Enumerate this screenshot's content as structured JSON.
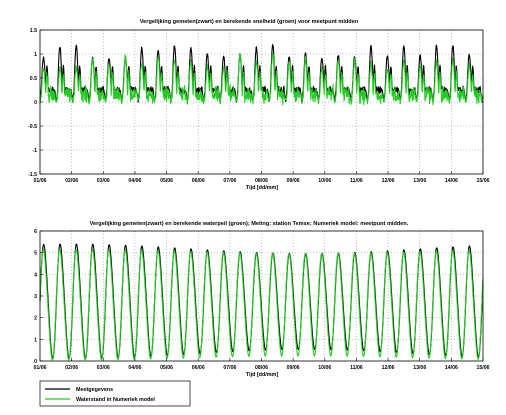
{
  "chart_data": [
    {
      "type": "line",
      "title": "Vergelijking gemeten(zwart) en berekende snelheid (groen) voor meetpunt midden",
      "xlabel": "Tijd [dd/mm]",
      "ylabel": "",
      "x_ticks": [
        "01/06",
        "02/06",
        "03/06",
        "04/06",
        "05/06",
        "06/06",
        "07/06",
        "08/06",
        "09/06",
        "10/06",
        "11/06",
        "12/06",
        "13/06",
        "14/06",
        "15/06"
      ],
      "y_ticks": [
        "1.5",
        "1",
        "0.5",
        "0",
        "-0.5",
        "-1",
        "-1.5"
      ],
      "ylim": [
        -1.5,
        1.5
      ],
      "xlim_days": [
        0,
        14
      ],
      "grid": true,
      "series": [
        {
          "color": "#000000",
          "tide_period_hours": 12.42,
          "baseline": 0.25,
          "peak_mean": 1.05,
          "peak_spread": 0.15,
          "secondary_peak": 0.75,
          "trough": 0.0
        },
        {
          "color": "#22cc22",
          "tide_period_hours": 12.42,
          "baseline": 0.15,
          "peak_mean": 0.82,
          "peak_spread": 0.18,
          "secondary_peak": 0.6,
          "trough": 0.0
        }
      ]
    },
    {
      "type": "line",
      "title": "Vergelijking gemeten(zwart) en berekende waterpeil (groen); Meting: station Temse; Numeriek model: meetpunt midden.",
      "xlabel": "Tijd [dd/mm]",
      "ylabel": "",
      "x_ticks": [
        "01/06",
        "02/06",
        "03/06",
        "04/06",
        "05/06",
        "06/06",
        "07/06",
        "08/06",
        "09/06",
        "10/06",
        "11/06",
        "12/06",
        "13/06",
        "14/06",
        "15/06"
      ],
      "y_ticks": [
        "6",
        "5",
        "4",
        "3",
        "2",
        "1",
        "0"
      ],
      "ylim": [
        0,
        6
      ],
      "xlim_days": [
        0,
        14
      ],
      "grid": true,
      "legend_position": "below",
      "series": [
        {
          "name": "Meetgegevens",
          "color": "#000000",
          "tide_period_hours": 12.42,
          "mean": 2.75,
          "amplitude_spring": 2.75,
          "amplitude_neap": 2.3
        },
        {
          "name": "Waterstand in Numeriek model",
          "color": "#22cc22",
          "tide_period_hours": 12.42,
          "mean": 2.6,
          "amplitude_spring": 2.65,
          "amplitude_neap": 2.45
        }
      ]
    }
  ]
}
